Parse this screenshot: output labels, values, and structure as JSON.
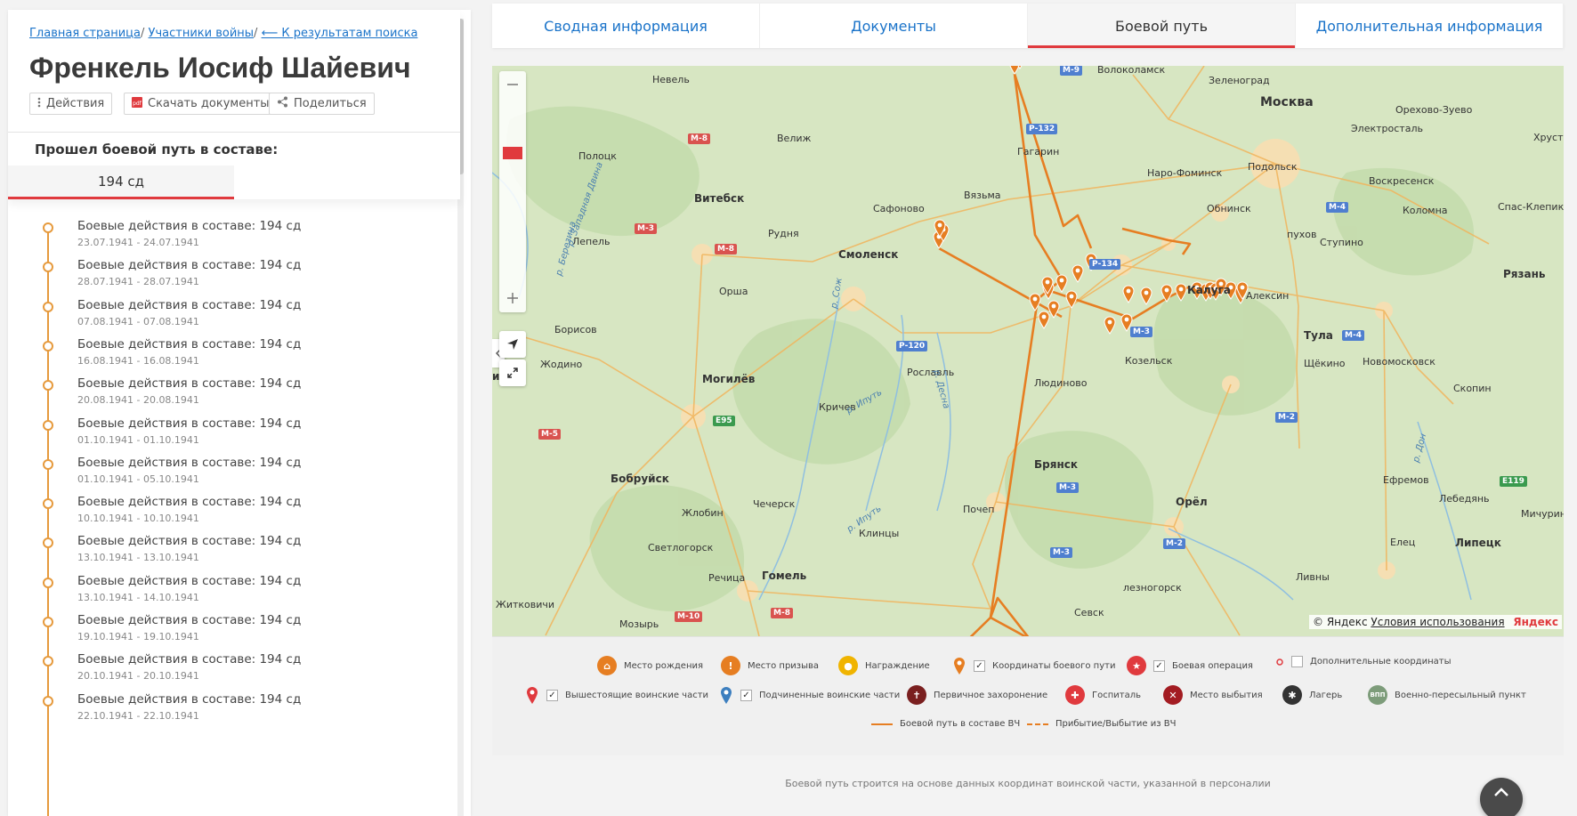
{
  "breadcrumb": {
    "home": "Главная страница",
    "sep1": "/",
    "participants": "Участники войны",
    "sep2": "/",
    "back": "⟵ К результатам поиска"
  },
  "person": {
    "name": "Френкель Иосиф Шайевич"
  },
  "actions": {
    "actions_label": "Действия",
    "download_label": "Скачать документы",
    "share_label": "Поделиться"
  },
  "combat_path": {
    "section_label": "Прошел боевой путь в составе:",
    "unit_tab": "194 сд",
    "events": [
      {
        "title": "Боевые действия в составе: 194 сд",
        "dates": "23.07.1941 - 24.07.1941"
      },
      {
        "title": "Боевые действия в составе: 194 сд",
        "dates": "28.07.1941 - 28.07.1941"
      },
      {
        "title": "Боевые действия в составе: 194 сд",
        "dates": "07.08.1941 - 07.08.1941"
      },
      {
        "title": "Боевые действия в составе: 194 сд",
        "dates": "16.08.1941 - 16.08.1941"
      },
      {
        "title": "Боевые действия в составе: 194 сд",
        "dates": "20.08.1941 - 20.08.1941"
      },
      {
        "title": "Боевые действия в составе: 194 сд",
        "dates": "01.10.1941 - 01.10.1941"
      },
      {
        "title": "Боевые действия в составе: 194 сд",
        "dates": "01.10.1941 - 05.10.1941"
      },
      {
        "title": "Боевые действия в составе: 194 сд",
        "dates": "10.10.1941 - 10.10.1941"
      },
      {
        "title": "Боевые действия в составе: 194 сд",
        "dates": "13.10.1941 - 13.10.1941"
      },
      {
        "title": "Боевые действия в составе: 194 сд",
        "dates": "13.10.1941 - 14.10.1941"
      },
      {
        "title": "Боевые действия в составе: 194 сд",
        "dates": "19.10.1941 - 19.10.1941"
      },
      {
        "title": "Боевые действия в составе: 194 сд",
        "dates": "20.10.1941 - 20.10.1941"
      },
      {
        "title": "Боевые действия в составе: 194 сд",
        "dates": "22.10.1941 - 22.10.1941"
      }
    ]
  },
  "tabs": [
    {
      "label": "Сводная информация"
    },
    {
      "label": "Документы"
    },
    {
      "label": "Боевой путь"
    },
    {
      "label": "Дополнительная информация"
    }
  ],
  "map": {
    "route_color": "#e67e22",
    "cities": {
      "nevel": "Невель",
      "velizh": "Велиж",
      "polotsk": "Полоцк",
      "vitebsk": "Витебск",
      "lepel": "Лепель",
      "rudnya": "Рудня",
      "smolensk": "Смоленск",
      "orsha": "Орша",
      "borisov": "Борисов",
      "zhodino": "Жодино",
      "minsk": "инск",
      "mogilev": "Могилёв",
      "krichev": "Кричев",
      "roslavl": "Рославль",
      "bobruisk": "Бобруйск",
      "zhlobin": "Жлобин",
      "chechersk": "Чечерск",
      "svetlogorsk": "Светлогорск",
      "rechitsa": "Речица",
      "gomel": "Гомель",
      "mozyr": "Мозырь",
      "zhitkovichi": "Житковичи",
      "klintsy": "Клинцы",
      "pochep": "Почеп",
      "bryansk": "Брянск",
      "sevsk": "Севск",
      "zheleznogorsk": "лезногорск",
      "orel": "Орёл",
      "lyudinovo": "Людиново",
      "kozelsk": "Козельск",
      "kaluga": "Калуга",
      "aleksin": "Алексин",
      "tula": "Тула",
      "shchekino": "Щёкино",
      "novomoskovsk": "Новомосковск",
      "skopin": "Скопин",
      "efremov": "Ефремов",
      "lebedyan": "Лебедянь",
      "lipetsk": "Липецк",
      "elets": "Елец",
      "livny": "Ливны",
      "michurinsk": "Мичурин",
      "ryazan": "Рязань",
      "spas_klepiki": "Спас-Клепики",
      "kolomna": "Коломна",
      "voskresensk": "Воскресенск",
      "stupino": "Ступино",
      "serpukhov": "пухов",
      "obninsk": "Обнинск",
      "naro_fominsk": "Наро-Фоминск",
      "podolsk": "Подольск",
      "moskva": "Москва",
      "zelenograd": "Зеленоград",
      "volokolamsk": "Волоколамск",
      "elektrostal": "Электросталь",
      "orekhovo": "Орехово-Зуево",
      "khrustal": "Хрустал",
      "gagarin": "Гагарин",
      "vyazma": "Вязьма",
      "safonovo": "Сафоново"
    },
    "rivers": {
      "dvina": "р. Западная Двина",
      "berezina": "р. Березина",
      "sozh": "р. Сож",
      "iput": "р. Ипуть",
      "iput2": "р. Ипуть",
      "desna": "р. Десна",
      "don": "р. Дон"
    },
    "roads": {
      "m9": "М-9",
      "r132": "Р-132",
      "m8a": "М-8",
      "m3a": "М-3",
      "m8b": "М-8",
      "r134": "Р-134",
      "r120": "Р-120",
      "m3b": "М-3",
      "e95": "E95",
      "m5": "М-5",
      "m3c": "М-3",
      "m3d": "М-3",
      "m10": "М-10",
      "m8c": "М-8",
      "m2a": "М-2",
      "m2b": "М-2",
      "m4a": "М-4",
      "m4b": "М-4",
      "e119": "E119"
    },
    "copyright_prefix": "© Яндекс",
    "terms_link": "Условия использования",
    "yandex_logo": "Яндекс"
  },
  "legend": {
    "birthplace": "Место рождения",
    "draft": "Место призыва",
    "award": "Награждение",
    "path_coords": "Координаты боевого пути",
    "operation": "Боевая операция",
    "extra_coords": "Дополнительные координаты",
    "superior_units": "Вышестоящие воинские части",
    "subordinate_units": "Подчиненные воинские части",
    "burial": "Первичное захоронение",
    "hospital": "Госпиталь",
    "departure": "Место выбытия",
    "camp": "Лагерь",
    "transit": "Военно-пересыльный пункт",
    "transit_badge": "ВПП",
    "route_line": "Боевой путь в составе ВЧ",
    "arrival_line": "Прибытие/Выбытие из ВЧ",
    "colors": {
      "birthplace": "#e67e22",
      "draft": "#e67e22",
      "award": "#f0b400",
      "path": "#e67e22",
      "operation": "#e03a3e",
      "superior": "#e03a3e",
      "subordinate": "#3d7fbf",
      "burial": "#7a1f1f",
      "hospital": "#e03a3e",
      "departure": "#a31c22",
      "camp": "#333333",
      "transit": "#7d9c7a"
    }
  },
  "footer": {
    "note": "Боевой путь строится на основе данных координат воинской части, указанной в персоналии"
  }
}
